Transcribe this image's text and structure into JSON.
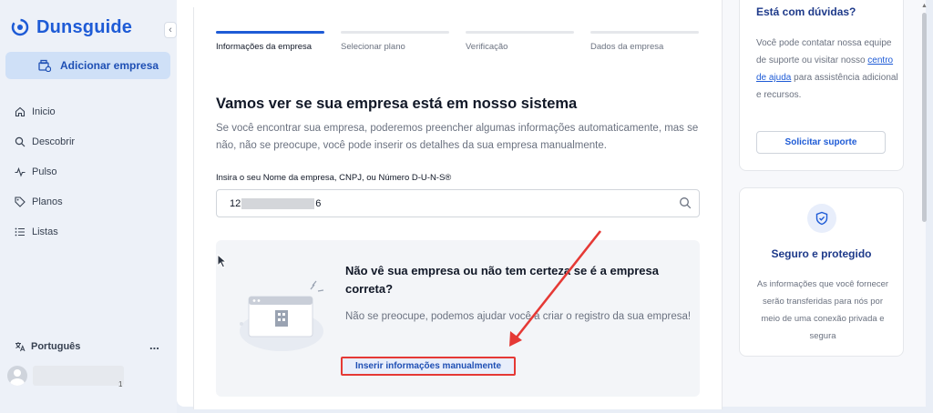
{
  "app": {
    "brand": "Dunsguide",
    "add_company_label": "Adicionar empresa",
    "nav": [
      {
        "label": "Inicio",
        "icon": "home-icon"
      },
      {
        "label": "Descobrir",
        "icon": "search-icon"
      },
      {
        "label": "Pulso",
        "icon": "pulse-icon"
      },
      {
        "label": "Planos",
        "icon": "tag-icon"
      },
      {
        "label": "Listas",
        "icon": "list-icon"
      }
    ],
    "language": "Português",
    "more": "...",
    "user_badge": "1"
  },
  "steps": [
    {
      "label": "Informações da empresa",
      "active": true
    },
    {
      "label": "Selecionar plano",
      "active": false
    },
    {
      "label": "Verificação",
      "active": false
    },
    {
      "label": "Dados da empresa",
      "active": false
    }
  ],
  "main": {
    "heading": "Vamos ver se sua empresa está em nosso sistema",
    "description": "Se você encontrar sua empresa, poderemos preencher algumas informações automaticamente, mas se não, não se preocupe, você pode inserir os detalhes da sua empresa manualmente.",
    "input_label": "Insira o seu Nome da empresa, CNPJ, ou Número D-U-N-S®",
    "input_value_prefix": "12",
    "input_value_suffix": "6"
  },
  "help_box": {
    "title": "Não vê sua empresa ou não tem certeza se é a empresa correta?",
    "text": "Não se preocupe, podemos ajudar você a criar o registro da sua empresa!",
    "manual_link": "Inserir informações manualmente"
  },
  "side": {
    "help_title": "Está com dúvidas?",
    "help_text_before": "Você pode contatar nossa equipe de suporte ou visitar nosso ",
    "help_link": "centro de ajuda",
    "help_text_after": " para assistência adicional e recursos.",
    "support_button": "Solicitar suporte",
    "secure_title": "Seguro e protegido",
    "secure_text": "As informações que você fornecer serão transferidas para nós por meio de uma conexão privada e segura"
  },
  "colors": {
    "primary": "#1e5bd6",
    "highlight": "#e53935",
    "active_nav_bg": "#cfe0f7"
  }
}
